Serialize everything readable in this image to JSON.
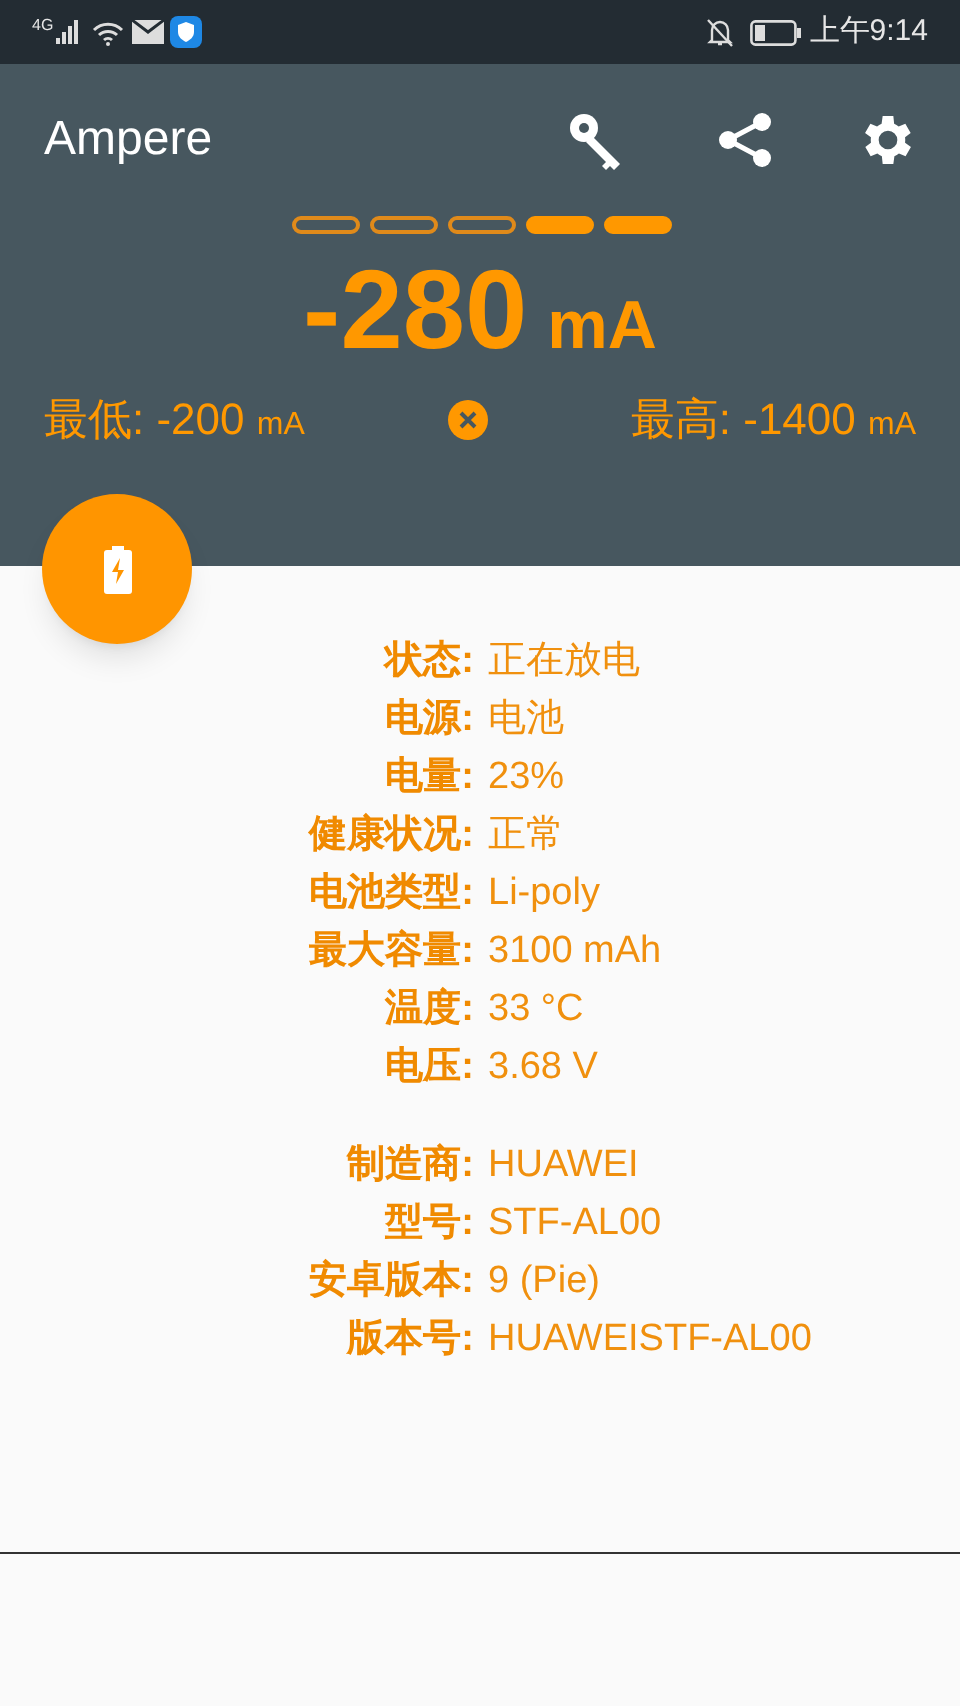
{
  "status_bar": {
    "network": "4G",
    "time": "上午9:14"
  },
  "toolbar": {
    "title": "Ampere"
  },
  "current": {
    "segments": [
      {
        "on": false
      },
      {
        "on": false
      },
      {
        "on": false
      },
      {
        "on": true
      },
      {
        "on": true
      }
    ],
    "value": "-280",
    "unit": "mA"
  },
  "min": {
    "label": "最低:",
    "value": "-200",
    "unit": "mA"
  },
  "max": {
    "label": "最高:",
    "value": "-1400",
    "unit": "mA"
  },
  "info_groups": [
    [
      {
        "label": "状态:",
        "value": "正在放电"
      },
      {
        "label": "电源:",
        "value": "电池"
      },
      {
        "label": "电量:",
        "value": "23%"
      },
      {
        "label": "健康状况:",
        "value": "正常"
      },
      {
        "label": "电池类型:",
        "value": "Li-poly"
      },
      {
        "label": "最大容量:",
        "value": "3100 mAh"
      },
      {
        "label": "温度:",
        "value": "33 °C"
      },
      {
        "label": "电压:",
        "value": "3.68 V"
      }
    ],
    [
      {
        "label": "制造商:",
        "value": "HUAWEI"
      },
      {
        "label": "型号:",
        "value": "STF-AL00"
      },
      {
        "label": "安卓版本:",
        "value": "9 (Pie)"
      },
      {
        "label": "版本号:",
        "value": "HUAWEISTF-AL00"
      }
    ]
  ]
}
